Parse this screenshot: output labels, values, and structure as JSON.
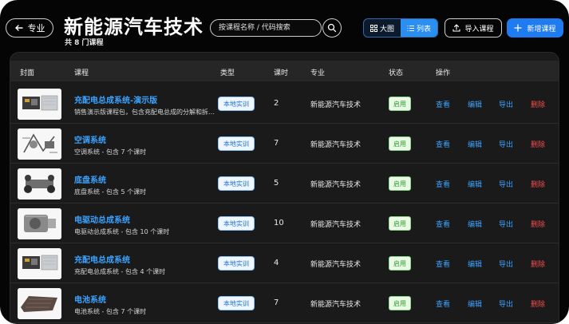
{
  "header": {
    "back_label": "专业",
    "title": "新能源汽车技术",
    "subtitle": "共 8 门课程",
    "search_placeholder": "按课程名称 / 代码搜索",
    "view_grid_label": "大图",
    "view_list_label": "列表",
    "import_label": "导入课程",
    "add_label": "新增课程"
  },
  "table": {
    "columns": [
      "封面",
      "课程",
      "类型",
      "课时",
      "专业",
      "状态",
      "操作"
    ],
    "actions": {
      "view": "查看",
      "edit": "编辑",
      "export": "导出",
      "delete": "删除"
    },
    "rows": [
      {
        "name": "充配电总成系统-演示版",
        "desc": "销售演示版课程包，包含充配电总成的分解和拆卸...",
        "type": "本地实训",
        "hours": "2",
        "major": "新能源汽车技术",
        "status": "启用",
        "cover_icon": "charging-unit-icon"
      },
      {
        "name": "空调系统",
        "desc": "空调系统 - 包含 7 个课时",
        "type": "本地实训",
        "hours": "7",
        "major": "新能源汽车技术",
        "status": "启用",
        "cover_icon": "ac-system-icon"
      },
      {
        "name": "底盘系统",
        "desc": "底盘系统 - 包含 5 个课时",
        "type": "本地实训",
        "hours": "5",
        "major": "新能源汽车技术",
        "status": "启用",
        "cover_icon": "chassis-icon"
      },
      {
        "name": "电驱动总成系统",
        "desc": "电驱动总成系统 - 包含 10 个课时",
        "type": "本地实训",
        "hours": "10",
        "major": "新能源汽车技术",
        "status": "启用",
        "cover_icon": "motor-icon"
      },
      {
        "name": "充配电总成系统",
        "desc": "充配电总成系统 - 包含 4 个课时",
        "type": "本地实训",
        "hours": "4",
        "major": "新能源汽车技术",
        "status": "启用",
        "cover_icon": "charging-unit-icon"
      },
      {
        "name": "电池系统",
        "desc": "电池系统 - 包含 7 个课时",
        "type": "本地实训",
        "hours": "7",
        "major": "新能源汽车技术",
        "status": "启用",
        "cover_icon": "battery-pack-icon"
      }
    ]
  },
  "colors": {
    "accent": "#1e7bf0",
    "link": "#3ba3ff",
    "delete": "#f24c4c",
    "status_green": "#2a9d2a"
  }
}
